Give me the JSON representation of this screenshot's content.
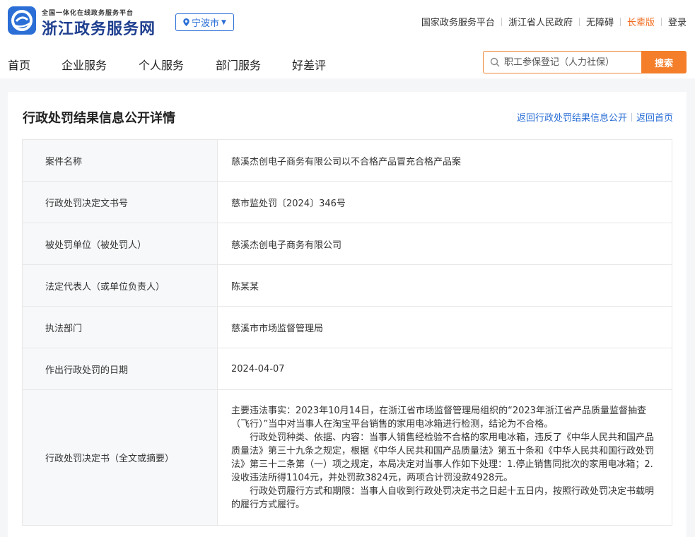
{
  "header": {
    "logo_small": "全国一体化在线政务服务平台",
    "logo_title": "浙江政务服务网",
    "city": "宁波市",
    "top_links": [
      "国家政务服务平台",
      "浙江省人民政府",
      "无障碍",
      "长辈版",
      "登录"
    ],
    "nav": [
      "首页",
      "企业服务",
      "个人服务",
      "部门服务",
      "好差评"
    ],
    "search": {
      "placeholder": "职工参保登记（人力社保）",
      "button": "搜索"
    },
    "colors": {
      "brand": "#2b6fd6",
      "accent": "#f47e2a"
    }
  },
  "page": {
    "title": "行政处罚结果信息公开详情",
    "back_link": "返回行政处罚结果信息公开",
    "home_link": "返回首页"
  },
  "rows": [
    {
      "label": "案件名称",
      "value": "慈溪杰创电子商务有限公司以不合格产品冒充合格产品案"
    },
    {
      "label": "行政处罚决定文书号",
      "value": "慈市监处罚〔2024〕346号"
    },
    {
      "label": "被处罚单位（被处罚人）",
      "value": "慈溪杰创电子商务有限公司"
    },
    {
      "label": "法定代表人（或单位负责人）",
      "value": "陈某某"
    },
    {
      "label": "执法部门",
      "value": "慈溪市市场监督管理局"
    },
    {
      "label": "作出行政处罚的日期",
      "value": "2024-04-07"
    }
  ],
  "decision": {
    "label": "行政处罚决定书（全文或摘要）",
    "paragraphs": [
      "主要违法事实：2023年10月14日，在浙江省市场监督管理局组织的“2023年浙江省产品质量监督抽查（飞行）”当中对当事人在淘宝平台销售的家用电冰箱进行检测，结论为不合格。",
      "行政处罚种类、依据、内容：当事人销售经检验不合格的家用电冰箱，违反了《中华人民共和国产品质量法》第三十九条之规定，根据《中华人民共和国产品质量法》第五十条和《中华人民共和国行政处罚法》第三十二条第（一）项之规定，本局决定对当事人作如下处理：1.停止销售同批次的家用电冰箱；2.没收违法所得1104元，并处罚款3824元，两项合计罚没款4928元。",
      "行政处罚履行方式和期限：当事人自收到行政处罚决定书之日起十五日内，按照行政处罚决定书载明的履行方式履行。"
    ]
  }
}
